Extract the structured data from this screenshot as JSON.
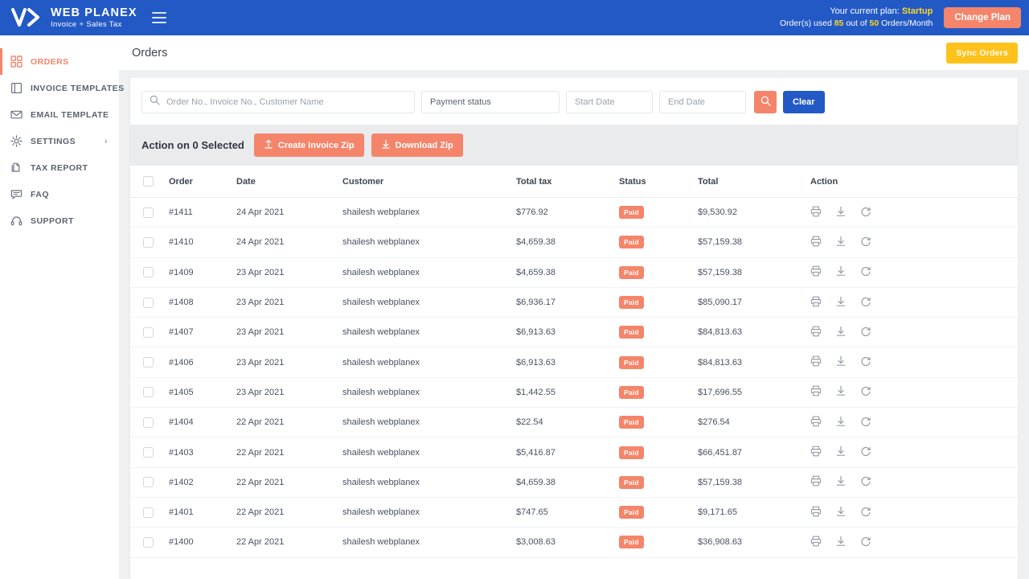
{
  "topbar": {
    "logo_title": "WEB PLANEX",
    "logo_subtitle": "Invoice + Sales Tax",
    "plan_prefix": "Your current plan:",
    "plan_name": "Startup",
    "usage_prefix": "Order(s) used",
    "usage_used": "85",
    "usage_middle": "out of",
    "usage_limit": "50",
    "usage_suffix": "Orders/Month",
    "change_plan_label": "Change Plan"
  },
  "sidebar": {
    "items": [
      {
        "label": "ORDERS",
        "icon": "grid-icon",
        "active": true
      },
      {
        "label": "INVOICE TEMPLATES",
        "icon": "document-icon",
        "active": false
      },
      {
        "label": "EMAIL TEMPLATE",
        "icon": "envelope-icon",
        "active": false
      },
      {
        "label": "SETTINGS",
        "icon": "gear-icon",
        "active": false,
        "caret": "›"
      },
      {
        "label": "TAX REPORT",
        "icon": "files-icon",
        "active": false
      },
      {
        "label": "FAQ",
        "icon": "chat-icon",
        "active": false
      },
      {
        "label": "SUPPORT",
        "icon": "headset-icon",
        "active": false
      }
    ]
  },
  "page": {
    "title": "Orders",
    "sync_label": "Sync Orders"
  },
  "filters": {
    "search_placeholder": "Order No., Invoice No., Customer Name",
    "search_value": "",
    "payment_status_label": "Payment status",
    "start_date_placeholder": "Start Date",
    "end_date_placeholder": "End Date",
    "clear_label": "Clear"
  },
  "action_bar": {
    "label": "Action on 0 Selected",
    "create_zip_label": "Create Invoice Zip",
    "download_zip_label": "Download Zip"
  },
  "table": {
    "headers": {
      "order": "Order",
      "date": "Date",
      "customer": "Customer",
      "total_tax": "Total tax",
      "status": "Status",
      "total": "Total",
      "action": "Action"
    },
    "rows": [
      {
        "order": "#1411",
        "date": "24 Apr 2021",
        "customer": "shailesh webplanex",
        "total_tax": "$776.92",
        "status": "Paid",
        "total": "$9,530.92"
      },
      {
        "order": "#1410",
        "date": "24 Apr 2021",
        "customer": "shailesh webplanex",
        "total_tax": "$4,659.38",
        "status": "Paid",
        "total": "$57,159.38"
      },
      {
        "order": "#1409",
        "date": "23 Apr 2021",
        "customer": "shailesh webplanex",
        "total_tax": "$4,659.38",
        "status": "Paid",
        "total": "$57,159.38"
      },
      {
        "order": "#1408",
        "date": "23 Apr 2021",
        "customer": "shailesh webplanex",
        "total_tax": "$6,936.17",
        "status": "Paid",
        "total": "$85,090.17"
      },
      {
        "order": "#1407",
        "date": "23 Apr 2021",
        "customer": "shailesh webplanex",
        "total_tax": "$6,913.63",
        "status": "Paid",
        "total": "$84,813.63"
      },
      {
        "order": "#1406",
        "date": "23 Apr 2021",
        "customer": "shailesh webplanex",
        "total_tax": "$6,913.63",
        "status": "Paid",
        "total": "$84,813.63"
      },
      {
        "order": "#1405",
        "date": "23 Apr 2021",
        "customer": "shailesh webplanex",
        "total_tax": "$1,442.55",
        "status": "Paid",
        "total": "$17,696.55"
      },
      {
        "order": "#1404",
        "date": "22 Apr 2021",
        "customer": "shailesh webplanex",
        "total_tax": "$22.54",
        "status": "Paid",
        "total": "$276.54"
      },
      {
        "order": "#1403",
        "date": "22 Apr 2021",
        "customer": "shailesh webplanex",
        "total_tax": "$5,416.87",
        "status": "Paid",
        "total": "$66,451.87"
      },
      {
        "order": "#1402",
        "date": "22 Apr 2021",
        "customer": "shailesh webplanex",
        "total_tax": "$4,659.38",
        "status": "Paid",
        "total": "$57,159.38"
      },
      {
        "order": "#1401",
        "date": "22 Apr 2021",
        "customer": "shailesh webplanex",
        "total_tax": "$747.65",
        "status": "Paid",
        "total": "$9,171.65"
      },
      {
        "order": "#1400",
        "date": "22 Apr 2021",
        "customer": "shailesh webplanex",
        "total_tax": "$3,008.63",
        "status": "Paid",
        "total": "$36,908.63"
      }
    ],
    "row_action_icons": [
      "print-icon",
      "download-icon",
      "refresh-icon"
    ]
  },
  "colors": {
    "brand_blue": "#2359C5",
    "accent_orange": "#F4856A",
    "accent_yellow": "#FFC21A",
    "highlight_yellow": "#FFD823",
    "action_bar_bg": "#e9ebed",
    "page_bg": "#eef0f2"
  }
}
